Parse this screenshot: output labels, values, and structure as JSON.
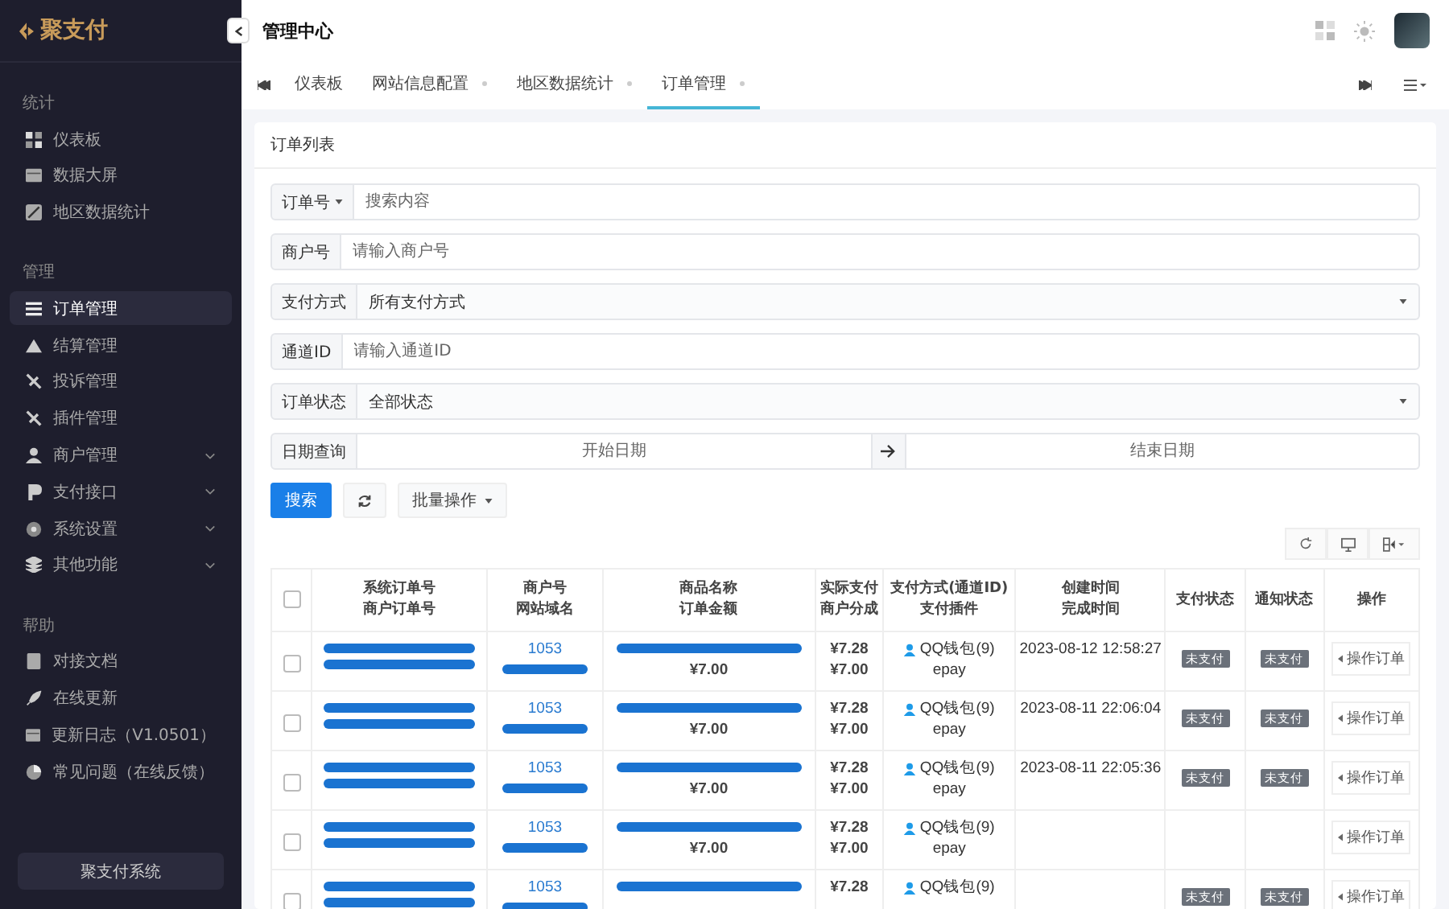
{
  "sidebar": {
    "logo": "聚支付",
    "sections": [
      {
        "title": "统计",
        "items": [
          {
            "label": "仪表板",
            "selected": false,
            "expandable": false
          },
          {
            "label": "数据大屏",
            "selected": false,
            "expandable": false
          },
          {
            "label": "地区数据统计",
            "selected": false,
            "expandable": false
          }
        ]
      },
      {
        "title": "管理",
        "items": [
          {
            "label": "订单管理",
            "selected": true,
            "expandable": false
          },
          {
            "label": "结算管理",
            "selected": false,
            "expandable": false
          },
          {
            "label": "投诉管理",
            "selected": false,
            "expandable": false
          },
          {
            "label": "插件管理",
            "selected": false,
            "expandable": false
          },
          {
            "label": "商户管理",
            "selected": false,
            "expandable": true
          },
          {
            "label": "支付接口",
            "selected": false,
            "expandable": true
          },
          {
            "label": "系统设置",
            "selected": false,
            "expandable": true
          },
          {
            "label": "其他功能",
            "selected": false,
            "expandable": true
          }
        ]
      },
      {
        "title": "帮助",
        "items": [
          {
            "label": "对接文档",
            "selected": false,
            "expandable": false
          },
          {
            "label": "在线更新",
            "selected": false,
            "expandable": false
          },
          {
            "label": "更新日志（V1.0501）",
            "selected": false,
            "expandable": false
          },
          {
            "label": "常见问题（在线反馈）",
            "selected": false,
            "expandable": false
          }
        ]
      }
    ],
    "footer_button": "聚支付系统"
  },
  "header": {
    "title": "管理中心"
  },
  "tabs": [
    {
      "label": "仪表板",
      "selected": false,
      "closable": false
    },
    {
      "label": "网站信息配置",
      "selected": false,
      "closable": true
    },
    {
      "label": "地区数据统计",
      "selected": false,
      "closable": true
    },
    {
      "label": "订单管理",
      "selected": true,
      "closable": true
    }
  ],
  "card": {
    "title": "订单列表",
    "filters": [
      {
        "kind": "input",
        "label": "订单号",
        "dropdown": true,
        "placeholder": "搜索内容"
      },
      {
        "kind": "input",
        "label": "商户号",
        "dropdown": false,
        "placeholder": "请输入商户号"
      },
      {
        "kind": "select",
        "label": "支付方式",
        "dropdown": false,
        "value": "所有支付方式"
      },
      {
        "kind": "input",
        "label": "通道ID",
        "dropdown": false,
        "placeholder": "请输入通道ID"
      },
      {
        "kind": "select",
        "label": "订单状态",
        "dropdown": false,
        "value": "全部状态"
      },
      {
        "kind": "date",
        "label": "日期查询",
        "dropdown": false,
        "placeholder": "开始日期",
        "placeholder_end": "结束日期"
      }
    ],
    "search_button": "搜索",
    "batch_button": "批量操作",
    "table": {
      "select_all_checked": false,
      "columns": [
        [
          "系统订单号",
          "商户订单号"
        ],
        [
          "商户号",
          "网站域名"
        ],
        [
          "商品名称",
          "订单金额"
        ],
        [
          "实际支付",
          "商户分成"
        ],
        [
          "支付方式(通道ID)",
          "支付插件"
        ],
        [
          "创建时间",
          "完成时间"
        ],
        [
          "支付状态"
        ],
        [
          "通知状态"
        ],
        [
          "操作"
        ]
      ],
      "rows": [
        {
          "checked": false,
          "merchant": "1053",
          "amount": "¥7.00",
          "paid": [
            "¥7.28",
            "¥7.00"
          ],
          "method": "QQ钱包(9)",
          "plugin": "epay",
          "created": "2023-08-12 12:58:27",
          "pay_status": "未支付",
          "notify_status": "未支付",
          "action": "操作订单"
        },
        {
          "checked": false,
          "merchant": "1053",
          "amount": "¥7.00",
          "paid": [
            "¥7.28",
            "¥7.00"
          ],
          "method": "QQ钱包(9)",
          "plugin": "epay",
          "created": "2023-08-11 22:06:04",
          "pay_status": "未支付",
          "notify_status": "未支付",
          "action": "操作订单"
        },
        {
          "checked": false,
          "merchant": "1053",
          "amount": "¥7.00",
          "paid": [
            "¥7.28",
            "¥7.00"
          ],
          "method": "QQ钱包(9)",
          "plugin": "epay",
          "created": "2023-08-11 22:05:36",
          "pay_status": "未支付",
          "notify_status": "未支付",
          "action": "操作订单"
        },
        {
          "checked": false,
          "merchant": "1053",
          "amount": "¥7.00",
          "paid": [
            "¥7.28",
            "¥7.00"
          ],
          "method": "QQ钱包(9)",
          "plugin": "epay",
          "action": "操作订单"
        },
        {
          "checked": false,
          "merchant": "1053",
          "paid": [
            "¥7.28"
          ],
          "method": "QQ钱包(9)",
          "pay_status": "未支付",
          "notify_status": "未支付",
          "action": "操作订单"
        }
      ]
    }
  }
}
